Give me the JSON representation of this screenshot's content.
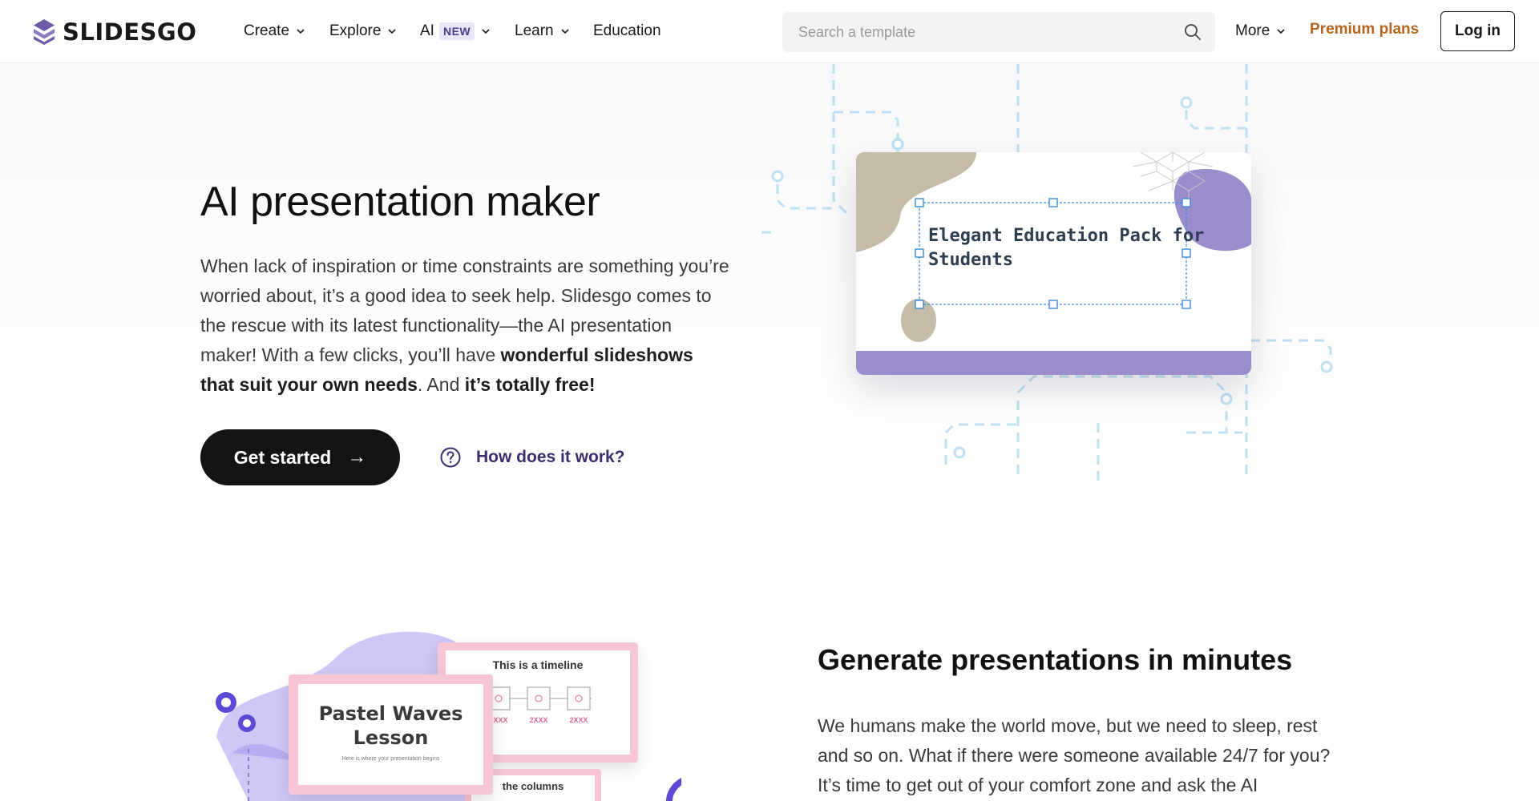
{
  "brand": {
    "name": "SLIDESGO",
    "color": "#6e5aa7"
  },
  "nav": {
    "items": [
      {
        "label": "Create",
        "has_dropdown": true
      },
      {
        "label": "Explore",
        "has_dropdown": true
      },
      {
        "label": "AI",
        "badge": "NEW",
        "has_dropdown": true
      },
      {
        "label": "Learn",
        "has_dropdown": true
      },
      {
        "label": "Education",
        "has_dropdown": false
      }
    ],
    "search_placeholder": "Search a template",
    "more_label": "More",
    "premium_label": "Premium plans",
    "login_label": "Log in",
    "accent_premium": "#b5651d"
  },
  "hero": {
    "title": "AI presentation maker",
    "desc_part1": "When lack of inspiration or time constraints are something you’re worried about, it’s a good idea to seek help. Slidesgo comes to the rescue with its latest functionality—the AI presentation maker! With a few clicks, you’ll have ",
    "desc_bold1": "wonderful slideshows that suit your own needs",
    "desc_part2": ". And ",
    "desc_bold2": "it’s totally free!",
    "cta_label": "Get started",
    "how_label": "How does it work?",
    "card_title": "Elegant Education Pack for Students"
  },
  "section2": {
    "title": "Generate presentations in minutes",
    "desc": "We humans make the world move, but we need to sleep, rest and so on. What if there were someone available 24/7 for you? It’s time to get out of your comfort zone and ask the AI",
    "illus_slide1_title": "Pastel Waves Lesson",
    "illus_slide1_sub": "Here is where your presentation begins",
    "illus_slide2_title": "This is a timeline",
    "illus_slide2_years": [
      "2XXX",
      "2XXX",
      "2XXX"
    ],
    "illus_slide3_title": "the columns"
  },
  "colors": {
    "card_purple": "#9b8ccc",
    "card_blob_tan": "#c4bba9",
    "circuit_blue": "#bfe0f2",
    "pink_frame": "#f7c6d6"
  }
}
